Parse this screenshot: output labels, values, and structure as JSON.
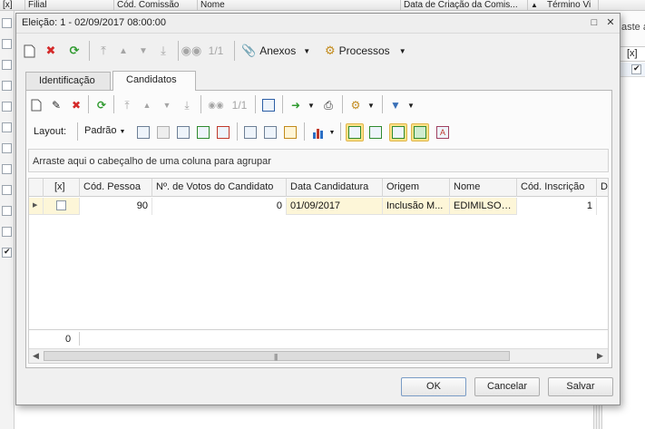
{
  "background": {
    "columns": [
      {
        "label": "[x]"
      },
      {
        "label": "Filial"
      },
      {
        "label": "Cód. Comissão"
      },
      {
        "label": "Nome"
      },
      {
        "label": "Data de Criação da Comis..."
      },
      {
        "label": "Término Vi"
      }
    ],
    "sort_icon": "sort-ascending-icon",
    "right_panel": {
      "header": "aste a",
      "column": "[x]"
    }
  },
  "dialog": {
    "title": "Eleição: 1 - 02/09/2017 08:00:00",
    "toolbar": {
      "record_position": "1/1",
      "anexos_label": "Anexos",
      "processos_label": "Processos"
    },
    "tabs": [
      {
        "label": "Identificação",
        "active": false
      },
      {
        "label": "Candidatos",
        "active": true
      }
    ],
    "grid_toolbar": {
      "record_position": "1/1",
      "layout_label": "Layout:",
      "layout_value": "Padrão"
    },
    "group_hint": "Arraste aqui o cabeçalho de uma coluna para agrupar",
    "grid": {
      "columns": [
        "[x]",
        "Cód. Pessoa",
        "Nº. de Votos do Candidato",
        "Data Candidatura",
        "Origem",
        "Nome",
        "Cód. Inscrição",
        "Da"
      ],
      "rows": [
        {
          "checked": false,
          "cod_pessoa": "90",
          "votos": "0",
          "data": "01/09/2017",
          "origem": "Inclusão M...",
          "nome": "EDIMILSON...",
          "inscricao": "1"
        }
      ],
      "footer_count": "0"
    },
    "buttons": {
      "ok": "OK",
      "cancel": "Cancelar",
      "save": "Salvar"
    }
  }
}
